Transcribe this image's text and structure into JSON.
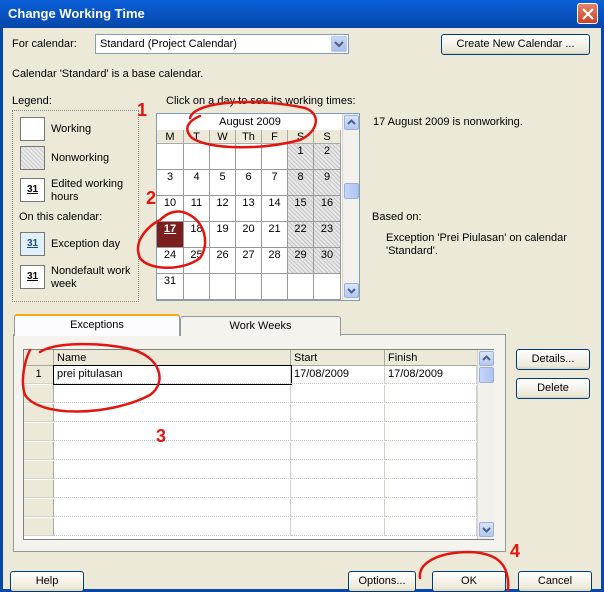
{
  "window": {
    "title": "Change Working Time"
  },
  "calendar_select": {
    "label": "For calendar:",
    "value": "Standard (Project Calendar)"
  },
  "create_calendar_button": "Create New Calendar ...",
  "base_calendar_note": "Calendar 'Standard' is a base calendar.",
  "legend": {
    "heading": "Legend:",
    "working": "Working",
    "nonworking": "Nonworking",
    "edited": "Edited working hours",
    "on_this_calendar": "On this calendar:",
    "exception": "Exception day",
    "nondefault": "Nondefault work week",
    "swatch_day": "31"
  },
  "calendar": {
    "instruction": "Click on a day to see its working times:",
    "month": "August 2009",
    "weekdays": [
      "M",
      "T",
      "W",
      "Th",
      "F",
      "S",
      "S"
    ],
    "selected_day": "17",
    "rows": [
      [
        "",
        "",
        "",
        "",
        "",
        "1",
        "2"
      ],
      [
        "3",
        "4",
        "5",
        "6",
        "7",
        "8",
        "9"
      ],
      [
        "10",
        "11",
        "12",
        "13",
        "14",
        "15",
        "16"
      ],
      [
        "17",
        "18",
        "19",
        "20",
        "21",
        "22",
        "23"
      ],
      [
        "24",
        "25",
        "26",
        "27",
        "28",
        "29",
        "30"
      ],
      [
        "31",
        "",
        "",
        "",
        "",
        "",
        ""
      ]
    ]
  },
  "info": {
    "status": "17 August 2009 is nonworking.",
    "based_on_label": "Based on:",
    "based_on_value": "Exception 'Prei Piulasan' on calendar 'Standard'."
  },
  "tabs": [
    "Exceptions",
    "Work Weeks"
  ],
  "exceptions_table": {
    "columns": [
      "Name",
      "Start",
      "Finish"
    ],
    "rows": [
      {
        "id": "1",
        "name": "prei pitulasan",
        "start": "17/08/2009",
        "finish": "17/08/2009"
      }
    ]
  },
  "side_buttons": {
    "details": "Details...",
    "delete": "Delete"
  },
  "footer": {
    "help": "Help",
    "options": "Options...",
    "ok": "OK",
    "cancel": "Cancel"
  },
  "annotations": [
    "1",
    "2",
    "3",
    "4"
  ],
  "colors": {
    "title_bar": "#0854c4",
    "annotation": "#e2160f",
    "selected_day": "#7a1e1e"
  }
}
